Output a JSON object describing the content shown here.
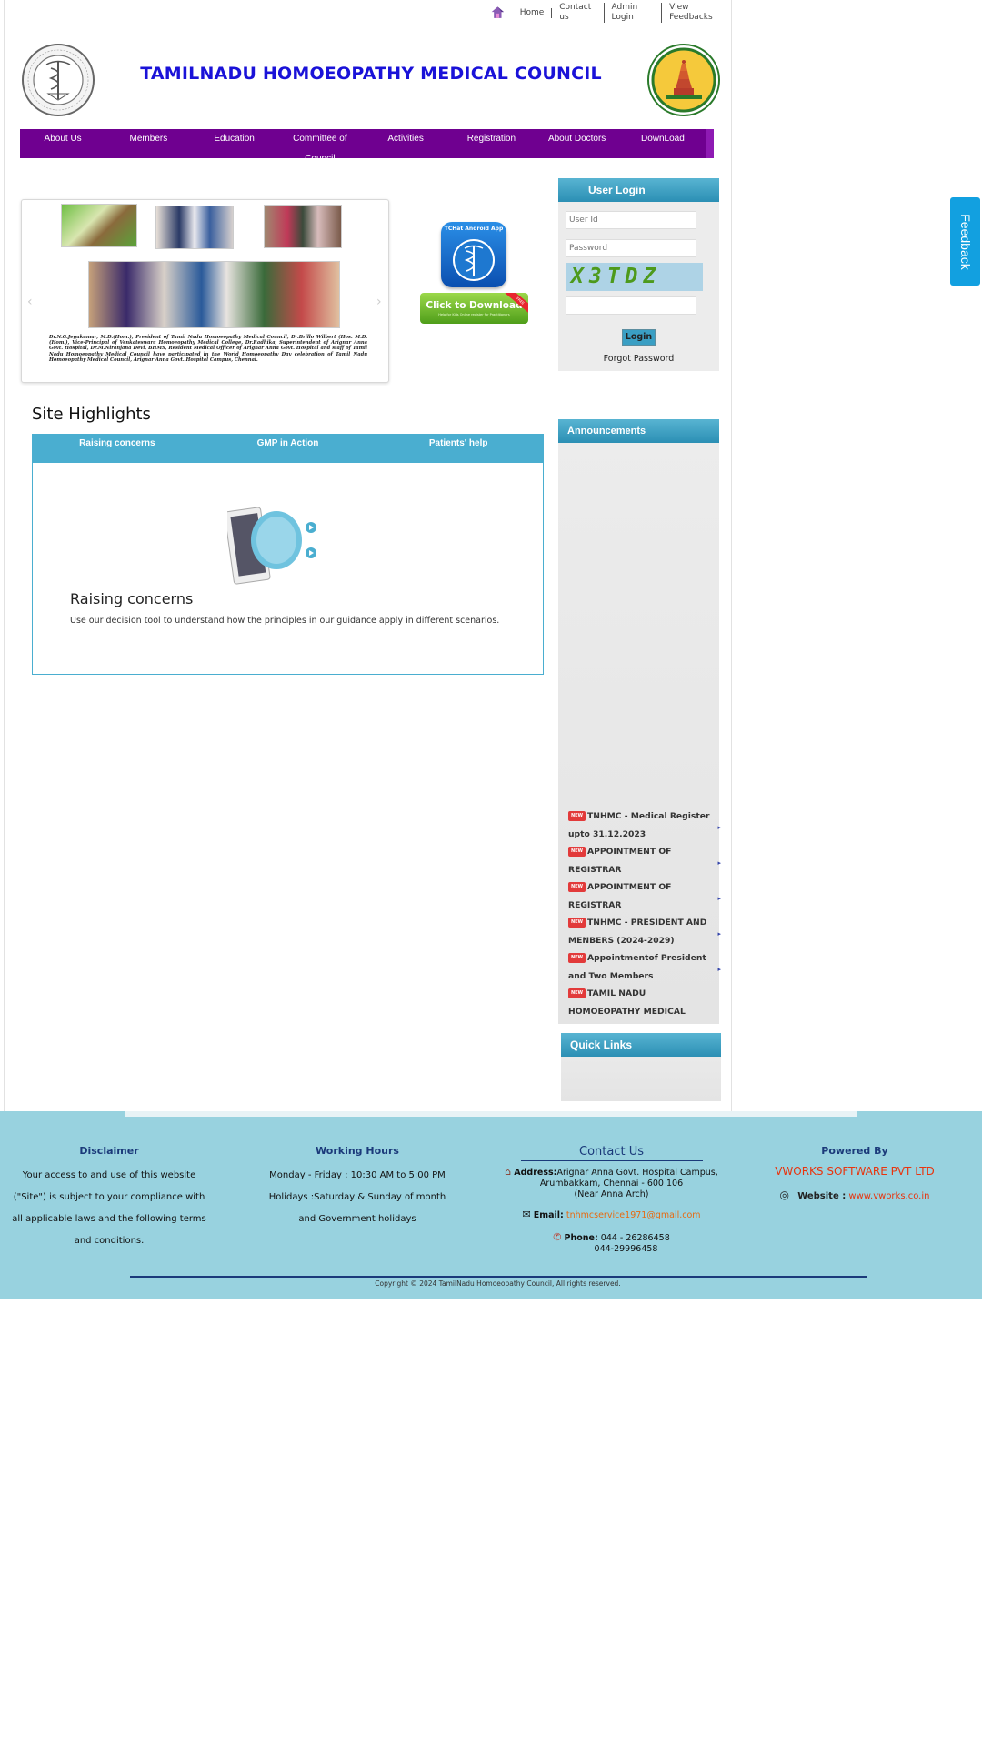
{
  "top_links": [
    "Home",
    "Contact us",
    "Admin Login",
    "View Feedbacks"
  ],
  "site_title": "TAMILNADU HOMOEOPATHY MEDICAL COUNCIL",
  "nav": [
    "About Us",
    "Members",
    "Education",
    "Committee of Council",
    "Activities",
    "Registration",
    "About Doctors",
    "DownLoad"
  ],
  "slider": {
    "caption": "Dr.N.G.Jegakumar, M.D.(Hom.), President of Tamil Nadu Homoeopathy Medical Council, Dr.Brillo Wilbert (Hos. M.D.(Hom.), Vice-Principal of Venkateswara Homoeopathy Medical College, Dr.Radhika, Superintendent of Arignar Anna Govt. Hospital, Dr.M.Niranjana Devi, BHMS, Resident Medical Officer of Arignar Anna Govt. Hospital and staff of Tamil Nadu Homoeopathy Medical Council have participated in the World Homoeopathy Day celebration of Tamil Nadu Homoeopathy Medical Council, Arignar Anna Govt. Hospital Campus, Chennai.",
    "prev": "‹",
    "next": "›"
  },
  "app_promo": {
    "icon_label": "TCHat Android App",
    "download_main": "Click to Download",
    "download_sub": "Help for Kids Online register for Practitioners",
    "ribbon": "FREE"
  },
  "login": {
    "title": "User Login",
    "user_placeholder": "User Id",
    "password_placeholder": "Password",
    "captcha": "X3TDZ",
    "button": "Login",
    "forgot": "Forgot Password"
  },
  "site_highlights": {
    "title": "Site Highlights",
    "tabs": [
      "Raising concerns",
      "GMP in Action",
      "Patients' help"
    ],
    "heading": "Raising concerns",
    "description": "Use our decision tool to understand how the principles in our guidance apply in different scenarios."
  },
  "announcements": {
    "title": "Announcements",
    "badge": "NEW",
    "items": [
      "TNHMC - Medical Register upto 31.12.2023",
      "APPOINTMENT OF REGISTRAR",
      "APPOINTMENT OF REGISTRAR",
      "TNHMC - PRESIDENT AND MENBERS (2024-2029)",
      "Appointmentof President and Two Members",
      "TAMIL NADU HOMOEOPATHY MEDICAL"
    ]
  },
  "quick_links": {
    "title": "Quick Links"
  },
  "feedback": "Feedback",
  "footer": {
    "disclaimer_title": "Disclaimer",
    "disclaimer_text": "Your access to and use of this website (\"Site\") is subject to your compliance with all applicable laws and the following terms and conditions.",
    "hours_title": "Working Hours",
    "hours_line1": "Monday - Friday : 10:30 AM to 5:00 PM",
    "hours_line2": "Holidays :Saturday & Sunday of month and Government holidays",
    "contact_title": "Contact Us",
    "address_label": "Address:",
    "address_line1": "Arignar Anna Govt. Hospital Campus,",
    "address_line2": "Arumbakkam, Chennai - 600 106",
    "address_line3": "(Near Anna Arch)",
    "email_label": "Email:",
    "email": "tnhmcservice1971@gmail.com",
    "phone_label": "Phone:",
    "phone1": "044 - 26286458",
    "phone2": "044-29996458",
    "powered_title": "Powered By",
    "powered_by": "VWORKS SOFTWARE PVT LTD",
    "website_label": "Website :",
    "website": "www.vworks.co.in",
    "copyright": "Copyright © 2024 TamilNadu Homoeopathy Council, All rights reserved."
  }
}
